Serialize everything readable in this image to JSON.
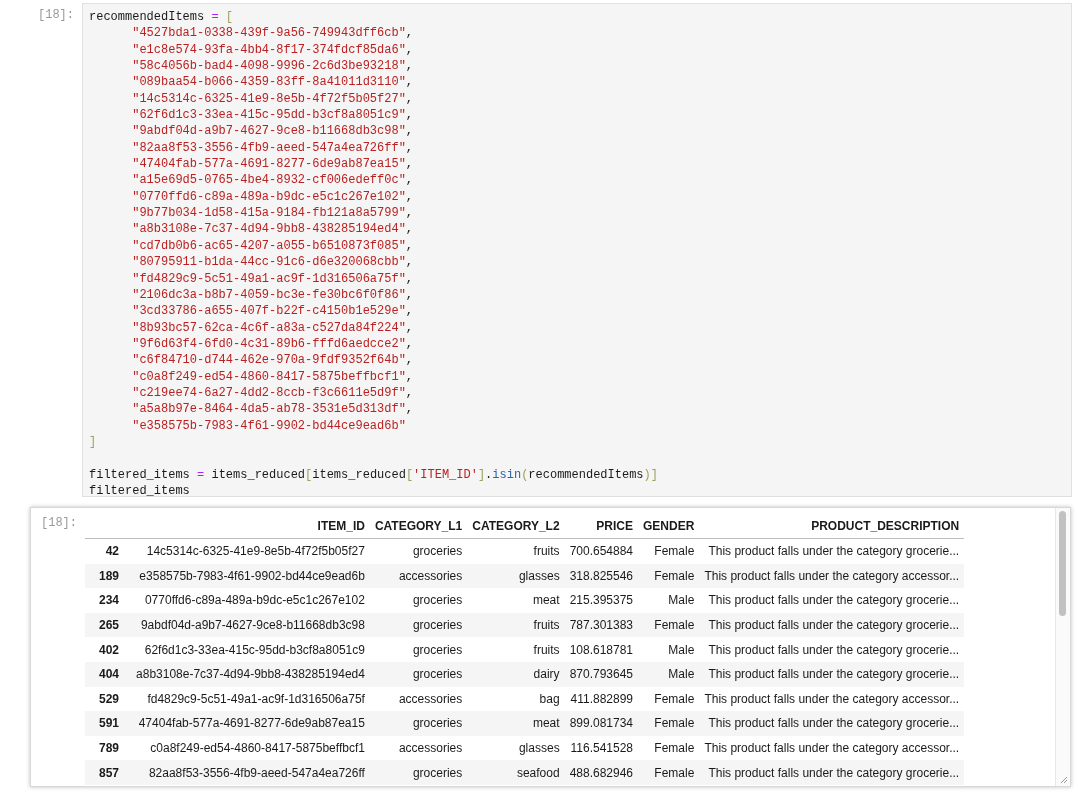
{
  "code_cell": {
    "prompt": "[18]:",
    "lines": [
      [
        {
          "t": "recommendedItems ",
          "kind": "name"
        },
        {
          "t": "= ",
          "kind": "op"
        },
        {
          "t": "[",
          "kind": "bracket"
        }
      ],
      [
        {
          "t": "      \"4527bda1-0338-439f-9a56-749943dff6cb\"",
          "kind": "string"
        },
        {
          "t": ",",
          "kind": "plain"
        }
      ],
      [
        {
          "t": "      \"e1c8e574-93fa-4bb4-8f17-374fdcf85da6\"",
          "kind": "string"
        },
        {
          "t": ",",
          "kind": "plain"
        }
      ],
      [
        {
          "t": "      \"58c4056b-bad4-4098-9996-2c6d3be93218\"",
          "kind": "string"
        },
        {
          "t": ",",
          "kind": "plain"
        }
      ],
      [
        {
          "t": "      \"089baa54-b066-4359-83ff-8a41011d3110\"",
          "kind": "string"
        },
        {
          "t": ",",
          "kind": "plain"
        }
      ],
      [
        {
          "t": "      \"14c5314c-6325-41e9-8e5b-4f72f5b05f27\"",
          "kind": "string"
        },
        {
          "t": ",",
          "kind": "plain"
        }
      ],
      [
        {
          "t": "      \"62f6d1c3-33ea-415c-95dd-b3cf8a8051c9\"",
          "kind": "string"
        },
        {
          "t": ",",
          "kind": "plain"
        }
      ],
      [
        {
          "t": "      \"9abdf04d-a9b7-4627-9ce8-b11668db3c98\"",
          "kind": "string"
        },
        {
          "t": ",",
          "kind": "plain"
        }
      ],
      [
        {
          "t": "      \"82aa8f53-3556-4fb9-aeed-547a4ea726ff\"",
          "kind": "string"
        },
        {
          "t": ",",
          "kind": "plain"
        }
      ],
      [
        {
          "t": "      \"47404fab-577a-4691-8277-6de9ab87ea15\"",
          "kind": "string"
        },
        {
          "t": ",",
          "kind": "plain"
        }
      ],
      [
        {
          "t": "      \"a15e69d5-0765-4be4-8932-cf006edeff0c\"",
          "kind": "string"
        },
        {
          "t": ",",
          "kind": "plain"
        }
      ],
      [
        {
          "t": "      \"0770ffd6-c89a-489a-b9dc-e5c1c267e102\"",
          "kind": "string"
        },
        {
          "t": ",",
          "kind": "plain"
        }
      ],
      [
        {
          "t": "      \"9b77b034-1d58-415a-9184-fb121a8a5799\"",
          "kind": "string"
        },
        {
          "t": ",",
          "kind": "plain"
        }
      ],
      [
        {
          "t": "      \"a8b3108e-7c37-4d94-9bb8-438285194ed4\"",
          "kind": "string"
        },
        {
          "t": ",",
          "kind": "plain"
        }
      ],
      [
        {
          "t": "      \"cd7db0b6-ac65-4207-a055-b6510873f085\"",
          "kind": "string"
        },
        {
          "t": ",",
          "kind": "plain"
        }
      ],
      [
        {
          "t": "      \"80795911-b1da-44cc-91c6-d6e320068cbb\"",
          "kind": "string"
        },
        {
          "t": ",",
          "kind": "plain"
        }
      ],
      [
        {
          "t": "      \"fd4829c9-5c51-49a1-ac9f-1d316506a75f\"",
          "kind": "string"
        },
        {
          "t": ",",
          "kind": "plain"
        }
      ],
      [
        {
          "t": "      \"2106dc3a-b8b7-4059-bc3e-fe30bc6f0f86\"",
          "kind": "string"
        },
        {
          "t": ",",
          "kind": "plain"
        }
      ],
      [
        {
          "t": "      \"3cd33786-a655-407f-b22f-c4150b1e529e\"",
          "kind": "string"
        },
        {
          "t": ",",
          "kind": "plain"
        }
      ],
      [
        {
          "t": "      \"8b93bc57-62ca-4c6f-a83a-c527da84f224\"",
          "kind": "string"
        },
        {
          "t": ",",
          "kind": "plain"
        }
      ],
      [
        {
          "t": "      \"9f6d63f4-6fd0-4c31-89b6-fffd6aedcce2\"",
          "kind": "string"
        },
        {
          "t": ",",
          "kind": "plain"
        }
      ],
      [
        {
          "t": "      \"c6f84710-d744-462e-970a-9fdf9352f64b\"",
          "kind": "string"
        },
        {
          "t": ",",
          "kind": "plain"
        }
      ],
      [
        {
          "t": "      \"c0a8f249-ed54-4860-8417-5875beffbcf1\"",
          "kind": "string"
        },
        {
          "t": ",",
          "kind": "plain"
        }
      ],
      [
        {
          "t": "      \"c219ee74-6a27-4dd2-8ccb-f3c6611e5d9f\"",
          "kind": "string"
        },
        {
          "t": ",",
          "kind": "plain"
        }
      ],
      [
        {
          "t": "      \"a5a8b97e-8464-4da5-ab78-3531e5d313df\"",
          "kind": "string"
        },
        {
          "t": ",",
          "kind": "plain"
        }
      ],
      [
        {
          "t": "      \"e358575b-7983-4f61-9902-bd44ce9ead6b\"",
          "kind": "string"
        }
      ],
      [
        {
          "t": "]",
          "kind": "bracket"
        }
      ],
      {
        "kind": "blank"
      },
      [
        {
          "t": "filtered_items ",
          "kind": "name"
        },
        {
          "t": "= ",
          "kind": "op"
        },
        {
          "t": "items_reduced",
          "kind": "name"
        },
        {
          "t": "[",
          "kind": "bracket"
        },
        {
          "t": "items_reduced",
          "kind": "name"
        },
        {
          "t": "[",
          "kind": "bracket"
        },
        {
          "t": "'ITEM_ID'",
          "kind": "string"
        },
        {
          "t": "]",
          "kind": "bracket"
        },
        {
          "t": ".",
          "kind": "plain"
        },
        {
          "t": "isin",
          "kind": "attr"
        },
        {
          "t": "(",
          "kind": "bracket"
        },
        {
          "t": "recommendedItems",
          "kind": "name"
        },
        {
          "t": ")",
          "kind": "bracket"
        },
        {
          "t": "]",
          "kind": "bracket"
        }
      ],
      [
        {
          "t": "filtered_items",
          "kind": "name"
        }
      ]
    ]
  },
  "output_cell": {
    "prompt": "[18]:",
    "table": {
      "columns": [
        "ITEM_ID",
        "CATEGORY_L1",
        "CATEGORY_L2",
        "PRICE",
        "GENDER",
        "PRODUCT_DESCRIPTION"
      ],
      "rows": [
        {
          "index": "42",
          "cells": [
            "14c5314c-6325-41e9-8e5b-4f72f5b05f27",
            "groceries",
            "fruits",
            "700.654884",
            "Female",
            "This product falls under the category grocerie..."
          ]
        },
        {
          "index": "189",
          "cells": [
            "e358575b-7983-4f61-9902-bd44ce9ead6b",
            "accessories",
            "glasses",
            "318.825546",
            "Female",
            "This product falls under the category accessor..."
          ]
        },
        {
          "index": "234",
          "cells": [
            "0770ffd6-c89a-489a-b9dc-e5c1c267e102",
            "groceries",
            "meat",
            "215.395375",
            "Male",
            "This product falls under the category grocerie..."
          ]
        },
        {
          "index": "265",
          "cells": [
            "9abdf04d-a9b7-4627-9ce8-b11668db3c98",
            "groceries",
            "fruits",
            "787.301383",
            "Female",
            "This product falls under the category grocerie..."
          ]
        },
        {
          "index": "402",
          "cells": [
            "62f6d1c3-33ea-415c-95dd-b3cf8a8051c9",
            "groceries",
            "fruits",
            "108.618781",
            "Male",
            "This product falls under the category grocerie..."
          ]
        },
        {
          "index": "404",
          "cells": [
            "a8b3108e-7c37-4d94-9bb8-438285194ed4",
            "groceries",
            "dairy",
            "870.793645",
            "Male",
            "This product falls under the category grocerie..."
          ]
        },
        {
          "index": "529",
          "cells": [
            "fd4829c9-5c51-49a1-ac9f-1d316506a75f",
            "accessories",
            "bag",
            "411.882899",
            "Female",
            "This product falls under the category accessor..."
          ]
        },
        {
          "index": "591",
          "cells": [
            "47404fab-577a-4691-8277-6de9ab87ea15",
            "groceries",
            "meat",
            "899.081734",
            "Female",
            "This product falls under the category grocerie..."
          ]
        },
        {
          "index": "789",
          "cells": [
            "c0a8f249-ed54-4860-8417-5875beffbcf1",
            "accessories",
            "glasses",
            "116.541528",
            "Female",
            "This product falls under the category accessor..."
          ]
        },
        {
          "index": "857",
          "cells": [
            "82aa8f53-3556-4fb9-aeed-547a4ea726ff",
            "groceries",
            "seafood",
            "488.682946",
            "Female",
            "This product falls under the category grocerie..."
          ]
        }
      ]
    }
  }
}
